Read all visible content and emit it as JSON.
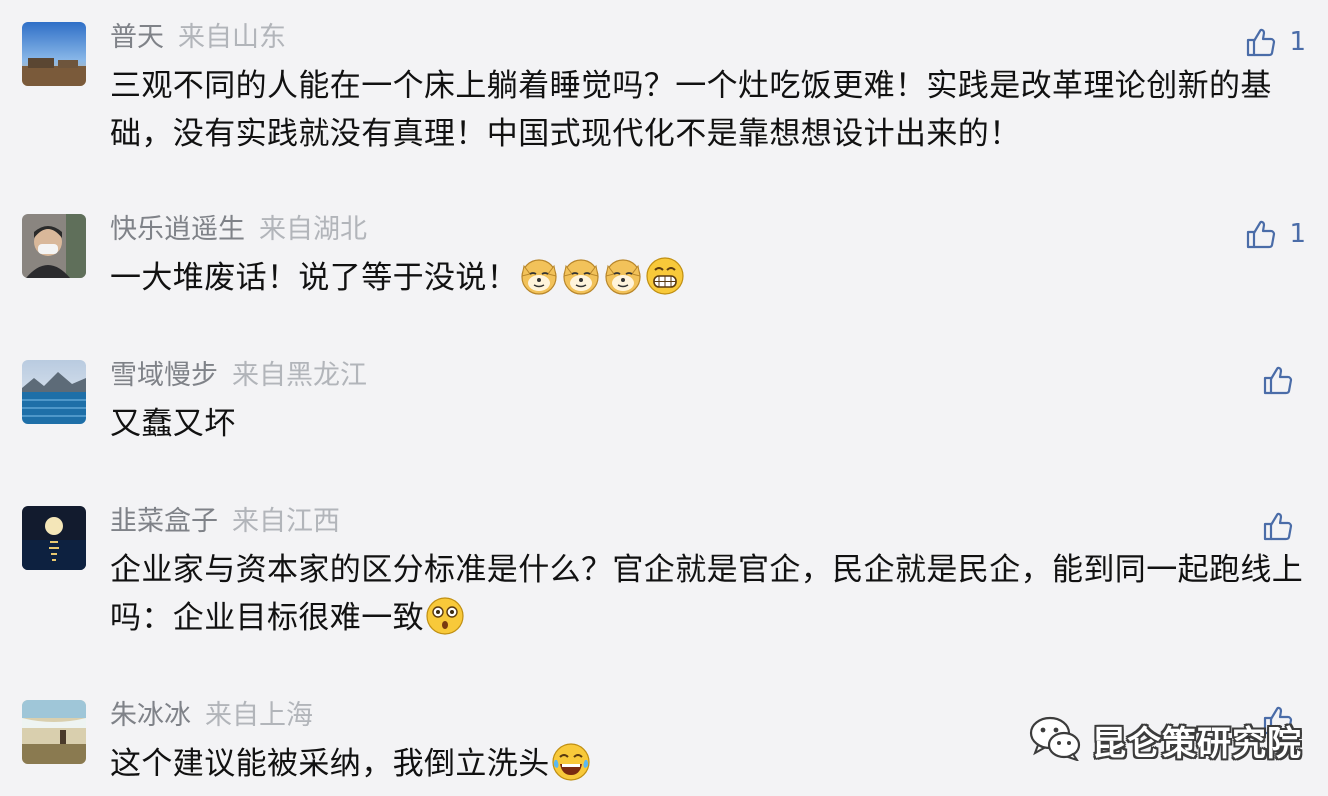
{
  "comments": [
    {
      "name": "普天",
      "location": "来自山东",
      "text": "三观不同的人能在一个床上躺着睡觉吗？一个灶吃饭更难！实践是改革理论创新的基础，没有实践就没有真理！中国式现代化不是靠想想设计出来的！",
      "likes": "1"
    },
    {
      "name": "快乐逍遥生",
      "location": "来自湖北",
      "text": "一大堆废话！说了等于没说！",
      "emojis": [
        "doge-icon",
        "doge-icon",
        "doge-icon",
        "grin-icon"
      ],
      "likes": "1"
    },
    {
      "name": "雪域慢步",
      "location": "来自黑龙江",
      "text": "又蠢又坏",
      "likes": ""
    },
    {
      "name": "韭菜盒子",
      "location": "来自江西",
      "text": "企业家与资本家的区分标准是什么？官企就是官企，民企就是民企，能到同一起跑线上吗：企业目标很难一致",
      "emojis": [
        "astonished-icon"
      ],
      "likes": ""
    },
    {
      "name": "朱冰冰",
      "location": "来自上海",
      "text": "这个建议能被采纳，我倒立洗头",
      "emojis": [
        "laugh-tears-icon"
      ],
      "likes": ""
    }
  ],
  "watermark": {
    "text": "昆仑策研究院",
    "icon": "wechat-icon"
  },
  "colors": {
    "background": "#f3f3f5",
    "name": "#7f8288",
    "location": "#b2b5ba",
    "text": "#111111",
    "like": "#4a6ca8"
  }
}
